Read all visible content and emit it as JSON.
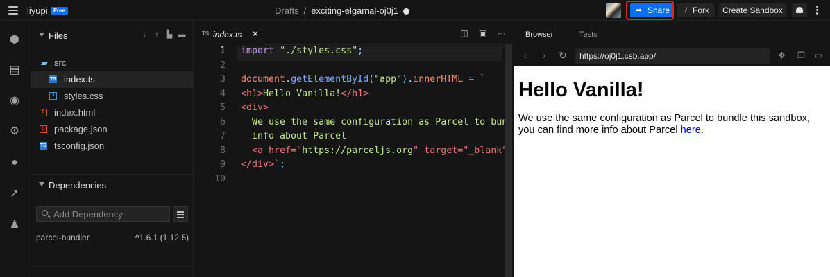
{
  "header": {
    "username": "liyupi",
    "plan_badge": "Free",
    "breadcrumb_parent": "Drafts",
    "breadcrumb_separator": "/",
    "sandbox_name": "exciting-elgamal-oj0j1",
    "share_label": "Share",
    "fork_label": "Fork",
    "create_label": "Create Sandbox",
    "accent_color": "#0971f1",
    "highlight_color": "#e0261c"
  },
  "activity_bar": {
    "icons": [
      "cube-icon",
      "file-icon",
      "search-icon",
      "gear-icon",
      "github-icon",
      "rocket-icon",
      "users-icon"
    ]
  },
  "sidebar": {
    "files_title": "Files",
    "tree": [
      {
        "label": "src",
        "type": "folder",
        "depth": 0,
        "selected": false
      },
      {
        "label": "index.ts",
        "type": "ts",
        "depth": 1,
        "selected": true
      },
      {
        "label": "styles.css",
        "type": "css",
        "depth": 1,
        "selected": false
      },
      {
        "label": "index.html",
        "type": "html",
        "depth": 0,
        "selected": false
      },
      {
        "label": "package.json",
        "type": "json",
        "depth": 0,
        "selected": false
      },
      {
        "label": "tsconfig.json",
        "type": "ts",
        "depth": 0,
        "selected": false
      }
    ],
    "dependencies_title": "Dependencies",
    "dependency_search_placeholder": "Add Dependency",
    "dependencies": [
      {
        "name": "parcel-bundler",
        "version": "^1.6.1 (1.12.5)"
      }
    ]
  },
  "editor": {
    "tab_lang": "TS",
    "tab_name": "index.ts",
    "tab_close": "×",
    "current_line": 1,
    "lines": [
      [
        {
          "t": "import",
          "c": "kw"
        },
        {
          "t": " ",
          "c": "txt"
        },
        {
          "t": "\"./styles.css\"",
          "c": "str"
        },
        {
          "t": ";",
          "c": "punc"
        }
      ],
      [],
      [
        {
          "t": "document",
          "c": "prop"
        },
        {
          "t": ".",
          "c": "punc"
        },
        {
          "t": "getElementById",
          "c": "fn"
        },
        {
          "t": "(",
          "c": "punc"
        },
        {
          "t": "\"app\"",
          "c": "str"
        },
        {
          "t": ").",
          "c": "punc"
        },
        {
          "t": "innerHTML",
          "c": "prop"
        },
        {
          "t": " = ",
          "c": "punc"
        },
        {
          "t": "`",
          "c": "str"
        }
      ],
      [
        {
          "t": "<h1>",
          "c": "tag"
        },
        {
          "t": "Hello Vanilla!",
          "c": "txt"
        },
        {
          "t": "</h1>",
          "c": "tag"
        }
      ],
      [
        {
          "t": "<div>",
          "c": "tag"
        }
      ],
      [
        {
          "t": "  We use the same configuration as Parcel to bun",
          "c": "txt"
        }
      ],
      [
        {
          "t": "  info about Parcel",
          "c": "txt"
        }
      ],
      [
        {
          "t": "  <a href=\"",
          "c": "tag"
        },
        {
          "t": "https://parceljs.org",
          "c": "url"
        },
        {
          "t": "\" target=\"_blank\"",
          "c": "tag"
        }
      ],
      [
        {
          "t": "</div>`",
          "c": "tag"
        },
        {
          "t": ";",
          "c": "punc"
        }
      ],
      []
    ]
  },
  "preview": {
    "tab_browser": "Browser",
    "tab_tests": "Tests",
    "url": "https://oj0j1.csb.app/",
    "heading": "Hello Vanilla!",
    "paragraph_before_link": "We use the same configuration as Parcel to bundle this sandbox, you can find more info about Parcel ",
    "link_text": "here",
    "paragraph_after_link": "."
  }
}
